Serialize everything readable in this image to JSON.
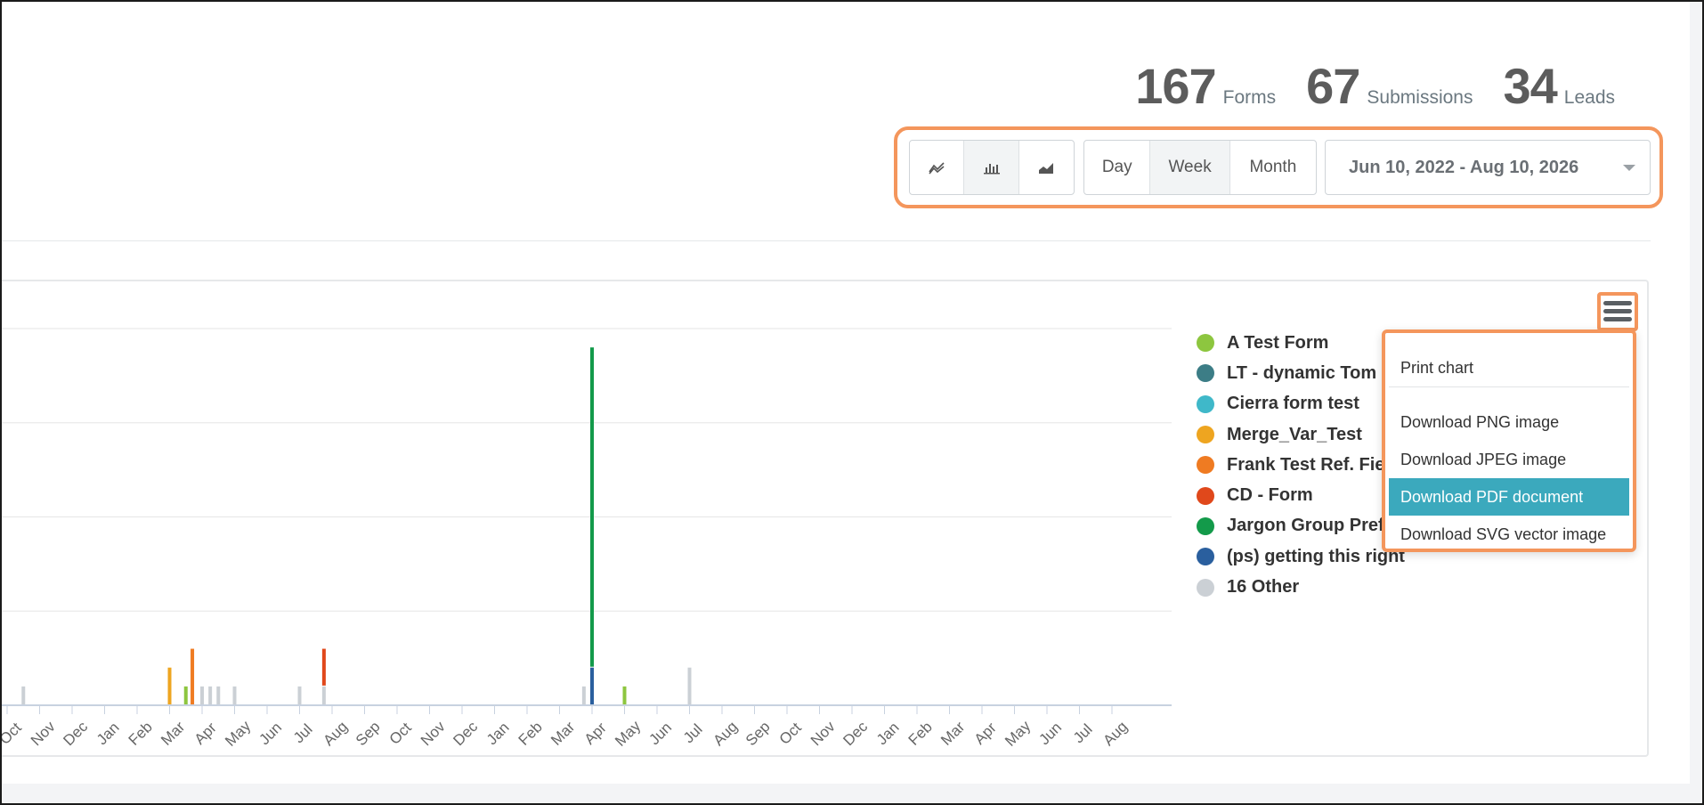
{
  "stats": [
    {
      "value": "167",
      "label": "Forms"
    },
    {
      "value": "67",
      "label": "Submissions"
    },
    {
      "value": "34",
      "label": "Leads"
    }
  ],
  "toolbar": {
    "chart_types": [
      {
        "icon": "line-chart-icon",
        "active": false
      },
      {
        "icon": "bar-chart-icon",
        "active": true
      },
      {
        "icon": "area-chart-icon",
        "active": false
      }
    ],
    "periods": {
      "day": "Day",
      "week": "Week",
      "month": "Month",
      "selected": "Week"
    },
    "date_range": "Jun 10, 2022 - Aug 10, 2026"
  },
  "export_menu": {
    "icon": "hamburger-menu-icon",
    "items": {
      "print": "Print chart",
      "png": "Download PNG image",
      "jpeg": "Download JPEG image",
      "pdf": "Download PDF document",
      "svg": "Download SVG vector image"
    },
    "highlighted": "Download PDF document",
    "highlight_color": "#3ba9bd"
  },
  "legend": [
    {
      "name": "A Test Form",
      "color": "#8dc63f"
    },
    {
      "name": "LT - dynamic Tom l",
      "color": "#3c7d86"
    },
    {
      "name": "Cierra form test",
      "color": "#3fb8c9"
    },
    {
      "name": "Merge_Var_Test",
      "color": "#eea520"
    },
    {
      "name": "Frank Test Ref. Fie",
      "color": "#ef7b22"
    },
    {
      "name": "CD - Form",
      "color": "#e0481b"
    },
    {
      "name": "Jargon Group Pref",
      "color": "#139a4a"
    },
    {
      "name": "(ps) getting this right",
      "color": "#2a5f9e"
    },
    {
      "name": "16 Other",
      "color": "#cbd0d5"
    }
  ],
  "chart_data": {
    "type": "bar",
    "stacked": true,
    "x_tick_labels": [
      "Oct",
      "Nov",
      "Dec",
      "Jan",
      "Feb",
      "Mar",
      "Apr",
      "May",
      "Jun",
      "Jul",
      "Aug",
      "Sep",
      "Oct",
      "Nov",
      "Dec",
      "Jan",
      "Feb",
      "Mar",
      "Apr",
      "May",
      "Jun",
      "Jul",
      "Aug",
      "Sep",
      "Oct",
      "Nov",
      "Dec",
      "Jan",
      "Feb",
      "Mar",
      "Apr",
      "May",
      "Jun",
      "Jul",
      "Aug"
    ],
    "ylim": [
      0,
      4
    ],
    "grid": true,
    "bars": [
      {
        "month": 0.5,
        "segments": [
          {
            "series": "16 Other",
            "value": 0.2
          }
        ]
      },
      {
        "month": 5.0,
        "segments": [
          {
            "series": "Merge_Var_Test",
            "value": 0.4
          }
        ]
      },
      {
        "month": 5.5,
        "segments": [
          {
            "series": "A Test Form",
            "value": 0.2
          }
        ]
      },
      {
        "month": 5.7,
        "segments": [
          {
            "series": "Frank Test Ref. Fie",
            "value": 0.6
          }
        ]
      },
      {
        "month": 6.0,
        "segments": [
          {
            "series": "16 Other",
            "value": 0.2
          }
        ]
      },
      {
        "month": 6.25,
        "segments": [
          {
            "series": "16 Other",
            "value": 0.2
          }
        ]
      },
      {
        "month": 6.5,
        "segments": [
          {
            "series": "16 Other",
            "value": 0.2
          }
        ]
      },
      {
        "month": 7.0,
        "segments": [
          {
            "series": "16 Other",
            "value": 0.2
          }
        ]
      },
      {
        "month": 9.0,
        "segments": [
          {
            "series": "16 Other",
            "value": 0.2
          }
        ]
      },
      {
        "month": 9.75,
        "segments": [
          {
            "series": "16 Other",
            "value": 0.2
          },
          {
            "series": "CD - Form",
            "value": 0.4
          }
        ]
      },
      {
        "month": 17.75,
        "segments": [
          {
            "series": "16 Other",
            "value": 0.2
          }
        ]
      },
      {
        "month": 18.0,
        "segments": [
          {
            "series": "(ps) getting this right",
            "value": 0.4
          },
          {
            "series": "Jargon Group Pref",
            "value": 3.4
          }
        ]
      },
      {
        "month": 19.0,
        "segments": [
          {
            "series": "A Test Form",
            "value": 0.2
          }
        ]
      },
      {
        "month": 21.0,
        "segments": [
          {
            "series": "16 Other",
            "value": 0.4
          }
        ]
      }
    ]
  }
}
